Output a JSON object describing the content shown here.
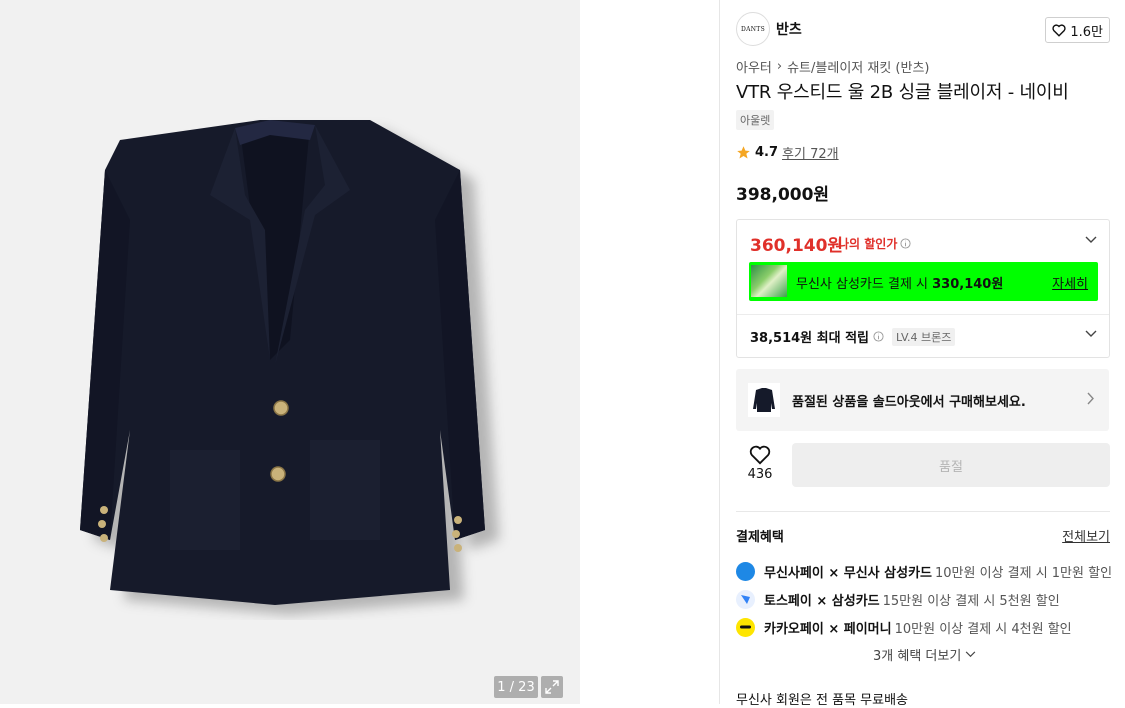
{
  "gallery": {
    "page_counter": "1 / 23",
    "expand_icon": "expand-icon"
  },
  "brand": {
    "logo_text": "DANTS",
    "name": "반츠",
    "favorite_count": "1.6만"
  },
  "breadcrumb": {
    "items": [
      "아우터",
      "슈트/블레이저 재킷 (반츠)"
    ]
  },
  "product": {
    "title": "VTR 우스티드 울 2B 싱글 블레이저 - 네이비",
    "tag": "아울렛",
    "rating": "4.7",
    "review_link": "후기 72개",
    "price": "398,000원"
  },
  "discount": {
    "my_price": "360,140원",
    "my_price_label": "나의 할인가",
    "card_text_prefix": "무신사 삼성카드 결제 시 ",
    "card_text_price": "330,140원",
    "card_detail": "자세히",
    "points": "38,514원 최대 적립",
    "level": "LV.4 브론즈"
  },
  "soldout": {
    "text": "품절된 상품을 솔드아웃에서 구매해보세요."
  },
  "actions": {
    "like_count": "436",
    "buy_label": "품절"
  },
  "benefits": {
    "title": "결제혜택",
    "view_all": "전체보기",
    "items": [
      {
        "name": "무신사페이 × 무신사 삼성카드",
        "desc": "10만원 이상 결제 시 1만원 할인",
        "icon_color": "#1e88e5"
      },
      {
        "name": "토스페이 × 삼성카드",
        "desc": "15만원 이상 결제 시 5천원 할인",
        "icon_color": "#3182f6"
      },
      {
        "name": "카카오페이 × 페이머니",
        "desc": "10만원 이상 결제 시 4천원 할인",
        "icon_color": "#fee500"
      }
    ],
    "more": "3개 혜택 더보기",
    "free_shipping": "무신사 회원은 전 품목 무료배송"
  }
}
